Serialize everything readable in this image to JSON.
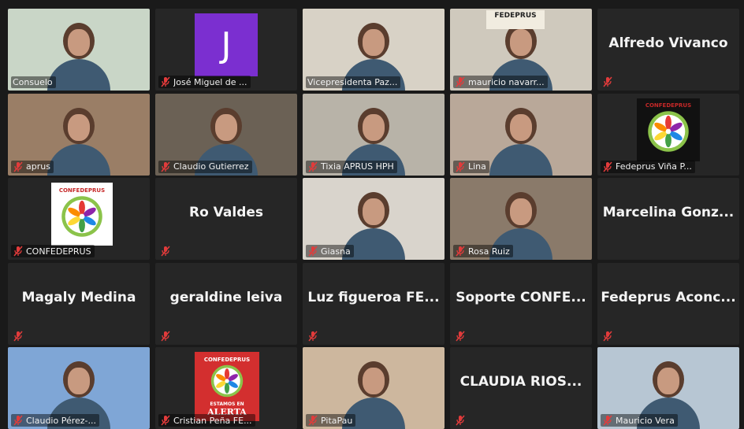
{
  "meeting": {
    "tiles": [
      {
        "id": "consuelo",
        "name": "Consuelo",
        "muted": false,
        "type": "video",
        "bg": "#c9d6c7"
      },
      {
        "id": "jose",
        "name": "José Miguel de ...",
        "muted": true,
        "type": "initial",
        "initial": "J"
      },
      {
        "id": "vice",
        "name": "Vicepresidenta Paz...",
        "muted": false,
        "type": "video",
        "active": true,
        "bg": "#d8d2c6"
      },
      {
        "id": "mauricio-n",
        "name": "mauricio navarr...",
        "muted": true,
        "type": "video",
        "bg": "#cfc9bd",
        "poster": "FEDEPRUS"
      },
      {
        "id": "alfredo",
        "name": "",
        "big": "Alfredo Vivanco",
        "muted": true,
        "type": "name"
      },
      {
        "id": "aprus",
        "name": "aprus",
        "muted": true,
        "type": "video",
        "bg": "#9a7e66"
      },
      {
        "id": "claudio-g",
        "name": "Claudio Gutierrez",
        "muted": true,
        "type": "video",
        "bg": "#6b6155"
      },
      {
        "id": "tixia",
        "name": "Tixia APRUS HPH",
        "muted": true,
        "type": "video",
        "bg": "#b8b3a8"
      },
      {
        "id": "lina",
        "name": "Lina",
        "muted": true,
        "type": "video",
        "bg": "#b9a899"
      },
      {
        "id": "fedeprus-vina",
        "name": "Fedeprus Viña P...",
        "muted": true,
        "type": "logo",
        "logo_text": "CONFEDEPRUS"
      },
      {
        "id": "confedeprus",
        "name": "CONFEDEPRUS",
        "muted": true,
        "type": "logo",
        "logo_text": "CONFEDEPRUS"
      },
      {
        "id": "ro",
        "name": "",
        "big": "Ro Valdes",
        "muted": true,
        "type": "name"
      },
      {
        "id": "giasna",
        "name": "Giasna",
        "muted": true,
        "type": "video",
        "bg": "#d9d4cc"
      },
      {
        "id": "rosa",
        "name": "Rosa Ruiz",
        "muted": true,
        "type": "video",
        "bg": "#8a7a6a"
      },
      {
        "id": "marcelina",
        "name": "",
        "big": "Marcelina Gonz...",
        "muted": false,
        "type": "name"
      },
      {
        "id": "magaly",
        "name": "",
        "big": "Magaly Medina",
        "muted": true,
        "type": "name"
      },
      {
        "id": "geraldine",
        "name": "",
        "big": "geraldine leiva",
        "muted": true,
        "type": "name"
      },
      {
        "id": "luz",
        "name": "",
        "big": "Luz figueroa FE...",
        "muted": true,
        "type": "name"
      },
      {
        "id": "soporte",
        "name": "",
        "big": "Soporte CONFE...",
        "muted": true,
        "type": "name"
      },
      {
        "id": "fedeprus-aconc",
        "name": "",
        "big": "Fedeprus Aconc...",
        "muted": true,
        "type": "name"
      },
      {
        "id": "claudio-p",
        "name": "Claudio Pérez-...",
        "muted": true,
        "type": "video",
        "bg": "#7fa6d6"
      },
      {
        "id": "cristian",
        "name": "Cristian Peña FE...",
        "muted": true,
        "type": "logo2",
        "logo_text": "CONFEDEPRUS",
        "banner": "ESTAMOS EN",
        "banner2": "ALERTA"
      },
      {
        "id": "pitapau",
        "name": "PitaPau",
        "muted": true,
        "type": "video",
        "bg": "#cdb79e"
      },
      {
        "id": "claudia",
        "name": "",
        "big": "CLAUDIA RIOS...",
        "muted": true,
        "type": "name"
      },
      {
        "id": "mauricio-v",
        "name": "Mauricio Vera",
        "muted": true,
        "type": "video",
        "bg": "#b7c6d3"
      }
    ]
  }
}
